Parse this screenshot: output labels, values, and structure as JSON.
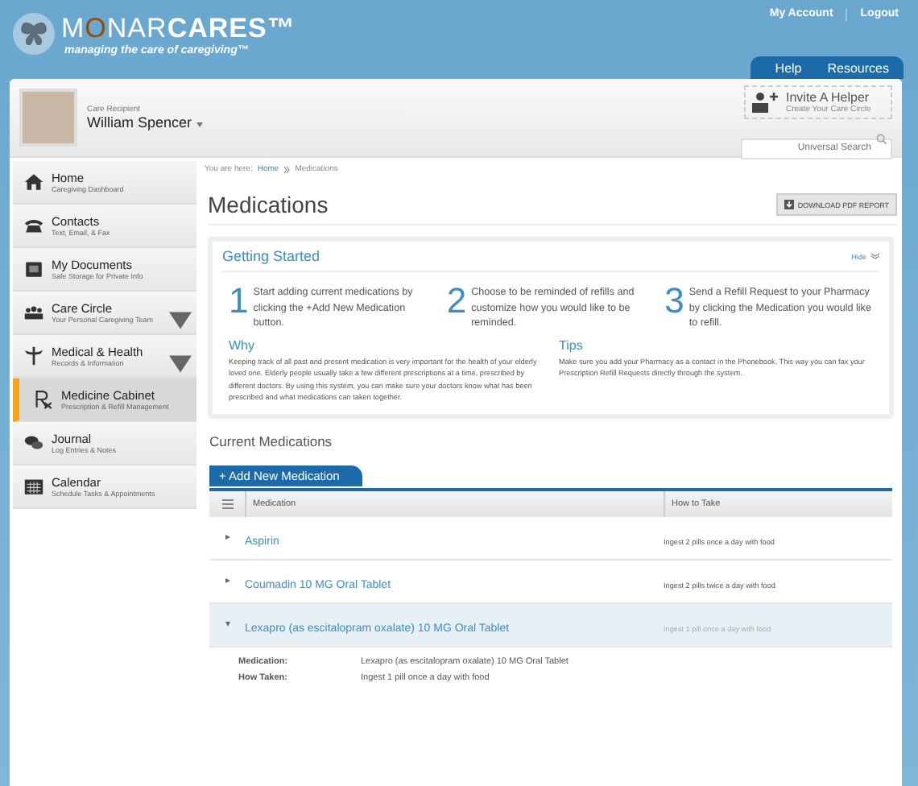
{
  "logo": {
    "parts": [
      {
        "text": "M",
        "kind": "light"
      },
      {
        "text": "O",
        "kind": "accent"
      },
      {
        "text": "NAR",
        "kind": "light"
      },
      {
        "text": "CARES™",
        "kind": "bold"
      }
    ],
    "tagline": "managing the care of caregiving™"
  },
  "top_links": [
    "My Account",
    "Logout"
  ],
  "top_tabs": [
    "Help",
    "Resources"
  ],
  "recipient": {
    "label": "Care Recipient",
    "name": "William Spencer"
  },
  "invite": {
    "title": "Invite A Helper",
    "subtitle": "Create Your Care Circle"
  },
  "search": {
    "placeholder": "Universal Search"
  },
  "sidebar": {
    "items": [
      {
        "kind": "home",
        "title": "Home",
        "subtitle": "Caregiving Dashboard",
        "selected": false,
        "expandable": false
      },
      {
        "kind": "phone",
        "title": "Contacts",
        "subtitle": "Text, Email, & Fax",
        "selected": false,
        "expandable": false
      },
      {
        "kind": "documents",
        "title": "My Documents",
        "subtitle": "Safe Storage for Private Info",
        "selected": false,
        "expandable": false
      },
      {
        "kind": "people",
        "title": "Care Circle",
        "subtitle": "Your Personal Caregiving Team",
        "selected": false,
        "expandable": true
      },
      {
        "kind": "caduceus",
        "title": "Medical & Health",
        "subtitle": "Records & Information",
        "selected": false,
        "expandable": true
      },
      {
        "kind": "rx",
        "title": "Medicine Cabinet",
        "subtitle": "Prescription & Refill Management",
        "selected": true,
        "expandable": false
      },
      {
        "kind": "chat",
        "title": "Journal",
        "subtitle": "Log Entries & Notes",
        "selected": false,
        "expandable": false
      },
      {
        "kind": "calendar",
        "title": "Calendar",
        "subtitle": "Schedule Tasks & Appointments",
        "selected": false,
        "expandable": false
      }
    ]
  },
  "breadcrumb": {
    "prefix": "You are here:",
    "items": [
      "Home",
      "Medications"
    ]
  },
  "page_title": "Medications",
  "download_button": "DOWNLOAD PDF REPORT",
  "getting_started": {
    "title": "Getting Started",
    "hide": "Hide",
    "steps": [
      {
        "number": "1",
        "text": "Start adding current medications by clicking the +Add New Medication button."
      },
      {
        "number": "2",
        "text": "Choose to be reminded of refills and customize how you would like to be reminded."
      },
      {
        "number": "3",
        "text": "Send a Refill Request to your Pharmacy by clicking the Medication you would like to refill."
      }
    ],
    "notes": [
      {
        "title": "Why",
        "text": "Keeping track of all past and present medication is very important for the health of your elderly loved one. Elderly people usually take a few different prescriptions at a time, prescribed by different doctors. By using this system, you can make sure your doctors know what has been prescribed and what medications can taken together."
      },
      {
        "title": "Tips",
        "text": "Make sure you add your Pharmacy as a contact in the Phonebook. This way you can fax your Prescription Refill Requests directly through the system."
      }
    ]
  },
  "current": {
    "title": "Current Medications",
    "add_button": "+ Add New Medication",
    "columns": [
      "Medication",
      "How to Take"
    ],
    "rows": [
      {
        "name": "Aspirin",
        "how_to_take": "Ingest 2 pills once a day with food",
        "expanded": false
      },
      {
        "name": "Coumadin 10 MG Oral Tablet",
        "how_to_take": "Ingest 2 pills twice a day with food",
        "expanded": false
      },
      {
        "name": "Lexapro (as escitalopram oxalate) 10 MG Oral Tablet",
        "how_to_take": "Ingest 1 pill once a day with food",
        "expanded": true,
        "details": [
          {
            "label": "Medication:",
            "value": "Lexapro (as escitalopram oxalate) 10 MG Oral Tablet"
          },
          {
            "label": "How Taken:",
            "value": "Ingest 1 pill once a day with food"
          }
        ]
      }
    ]
  }
}
